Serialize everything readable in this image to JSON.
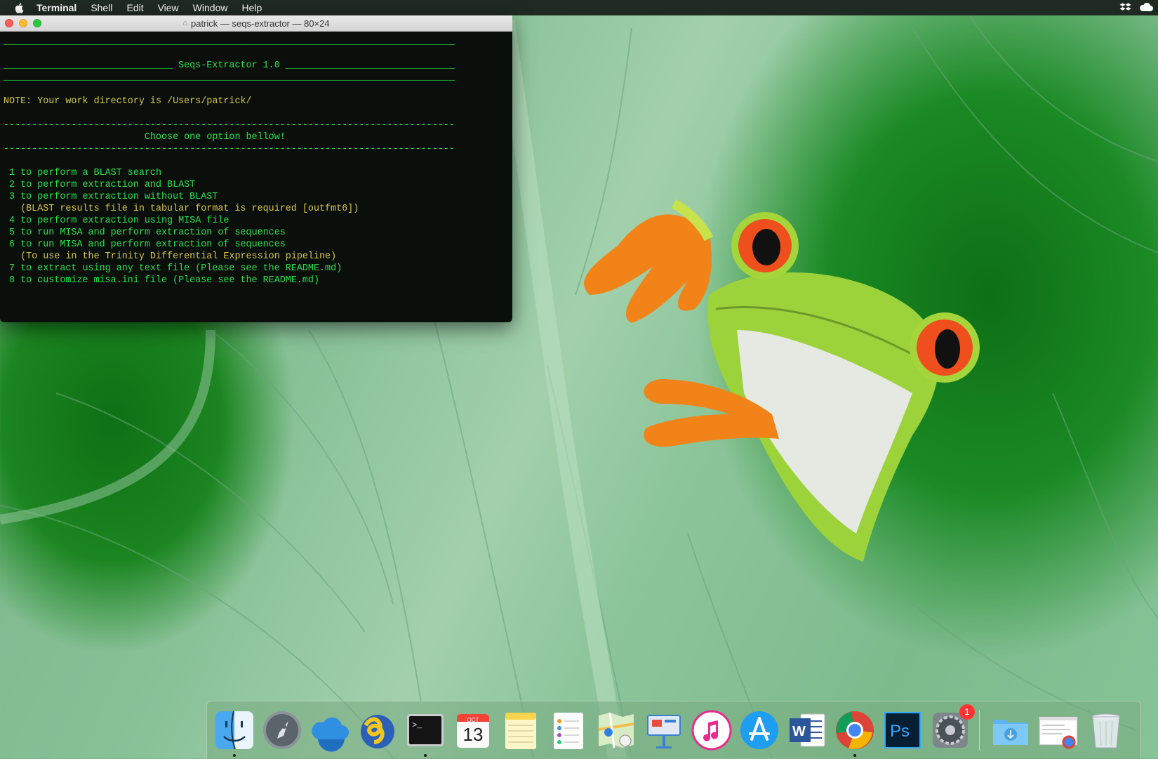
{
  "menubar": {
    "app_name": "Terminal",
    "items": [
      "Shell",
      "Edit",
      "View",
      "Window",
      "Help"
    ]
  },
  "terminal": {
    "title": "patrick — seqs-extractor — 80×24",
    "rule": "________________________________________________________________________________",
    "header_left": "______________________________",
    "header_title": " Seqs-Extractor 1.0 ",
    "header_right": "______________________________",
    "note": "NOTE: Your work directory is /Users/patrick/",
    "dashes": "--------------------------------------------------------------------------------",
    "choose": "                         Choose one option bellow!",
    "options": [
      " 1 to perform a BLAST search",
      " 2 to perform extraction and BLAST",
      " 3 to perform extraction without BLAST",
      "   (BLAST results file in tabular format is required [outfmt6])",
      " 4 to perform extraction using MISA file",
      " 5 to run MISA and perform extraction of sequences",
      " 6 to run MISA and perform extraction of sequences",
      "   (To use in the Trinity Differential Expression pipeline)",
      " 7 to extract using any text file (Please see the README.md)",
      " 8 to customize misa.ini file (Please see the README.md)"
    ]
  },
  "dock": {
    "calendar_month": "OCT",
    "calendar_day": "13",
    "settings_badge": "1",
    "icons": [
      "finder-icon",
      "launchpad-icon",
      "icloud-icon",
      "fetch-icon",
      "terminal-icon",
      "calendar-icon",
      "notes-icon",
      "reminders-icon",
      "maps-icon",
      "keynote-icon",
      "itunes-icon",
      "app-store-icon",
      "word-icon",
      "chrome-icon",
      "photoshop-icon",
      "system-preferences-icon",
      "downloads-folder-icon",
      "chrome-window-icon",
      "trash-icon"
    ]
  },
  "colors": {
    "terminal_text": "#26e24b",
    "terminal_note": "#d8c846",
    "terminal_bg": "#0b0f0c",
    "menubar_bg": "#1f2a22"
  }
}
